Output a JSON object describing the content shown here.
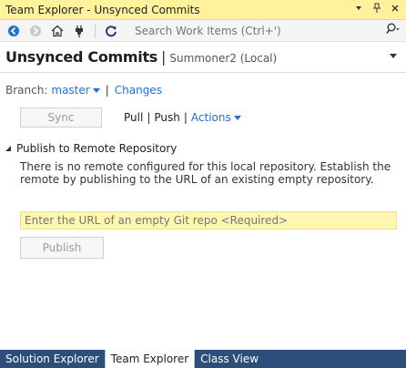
{
  "window": {
    "title": "Team Explorer - Unsynced Commits",
    "dropdown_icon": "chevron-down-icon",
    "pin_icon": "pin-icon",
    "close_icon": "close-icon"
  },
  "toolbar": {
    "back_icon": "back-icon",
    "forward_icon": "forward-icon",
    "home_icon": "home-icon",
    "connect_icon": "plug-icon",
    "refresh_icon": "refresh-icon",
    "search_placeholder": "Search Work Items (Ctrl+')",
    "search_icon": "search-icon"
  },
  "header": {
    "title": "Unsynced Commits",
    "divider": "|",
    "subtitle": "Summoner2 (Local)"
  },
  "branch": {
    "label": "Branch:",
    "value": "master",
    "separator": "|",
    "changes_link": "Changes"
  },
  "sync": {
    "sync_label": "Sync",
    "pull_label": "Pull",
    "sep1": "|",
    "push_label": "Push",
    "sep2": "|",
    "actions_label": "Actions"
  },
  "publish_section": {
    "header": "Publish to Remote Repository",
    "message": "There is no remote configured for this local repository. Establish the remote by publishing to the URL of an existing empty repository.",
    "url_placeholder": "Enter the URL of an empty Git repo <Required>",
    "publish_label": "Publish"
  },
  "bottom_tabs": [
    {
      "label": "Solution Explorer",
      "active": false
    },
    {
      "label": "Team Explorer",
      "active": true
    },
    {
      "label": "Class View",
      "active": false
    }
  ],
  "colors": {
    "titlebar_bg": "#fff29d",
    "link": "#1e6fd9",
    "url_input_bg": "#fff7b0",
    "bottom_tab_bar": "#2d4d7a"
  }
}
